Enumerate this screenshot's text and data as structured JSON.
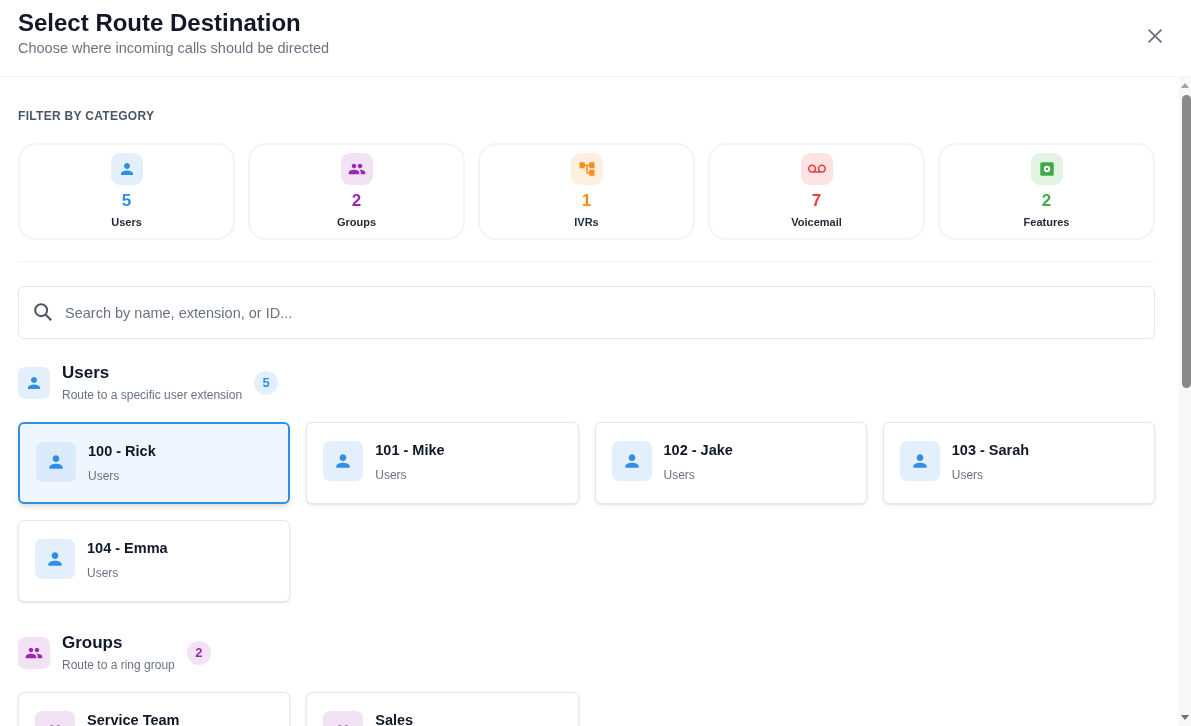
{
  "dialog": {
    "title": "Select Route Destination",
    "subtitle": "Choose where incoming calls should be directed"
  },
  "filter": {
    "heading": "FILTER BY CATEGORY",
    "categories": [
      {
        "kind": "users",
        "count": "5",
        "label": "Users"
      },
      {
        "kind": "groups",
        "count": "2",
        "label": "Groups"
      },
      {
        "kind": "ivrs",
        "count": "1",
        "label": "IVRs"
      },
      {
        "kind": "voicemail",
        "count": "7",
        "label": "Voicemail"
      },
      {
        "kind": "features",
        "count": "2",
        "label": "Features"
      }
    ]
  },
  "search": {
    "placeholder": "Search by name, extension, or ID..."
  },
  "sections": [
    {
      "kind": "users",
      "title": "Users",
      "description": "Route to a specific user extension",
      "count": "5",
      "items": [
        {
          "name": "100 - Rick",
          "subtitle": "Users",
          "selected": true
        },
        {
          "name": "101 - Mike",
          "subtitle": "Users",
          "selected": false
        },
        {
          "name": "102 - Jake",
          "subtitle": "Users",
          "selected": false
        },
        {
          "name": "103 - Sarah",
          "subtitle": "Users",
          "selected": false
        },
        {
          "name": "104 - Emma",
          "subtitle": "Users",
          "selected": false
        }
      ]
    },
    {
      "kind": "groups",
      "title": "Groups",
      "description": "Route to a ring group",
      "count": "2",
      "items": [
        {
          "name": "Service Team",
          "selected": false
        },
        {
          "name": "Sales",
          "selected": false
        }
      ]
    }
  ]
}
